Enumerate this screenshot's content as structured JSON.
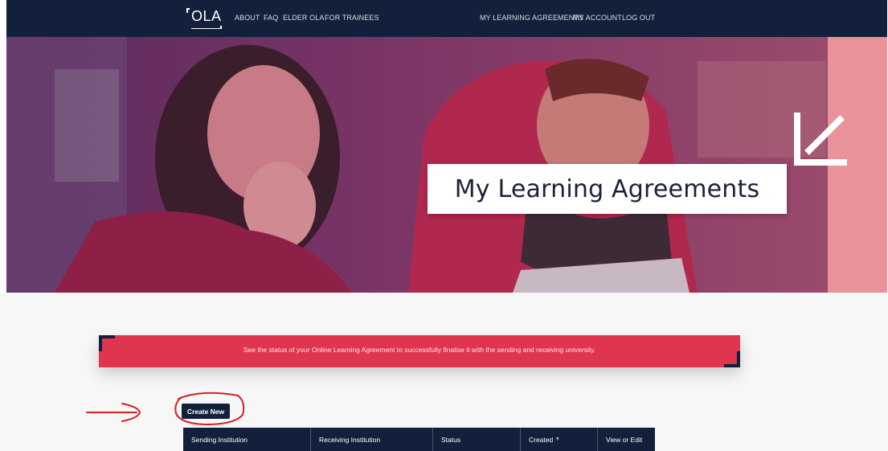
{
  "nav": {
    "logo_text": "OLA",
    "left_links": [
      "ABOUT",
      "FAQ",
      "ELDER OLA",
      "FOR TRAINEES"
    ],
    "right_links": [
      "MY LEARNING AGREEMENTS",
      "MY ACCOUNT",
      "LOG OUT"
    ]
  },
  "hero": {
    "title": "My Learning Agreements"
  },
  "banner": {
    "text": "See the status of your Online Learning Agreement to successfully finalise it with the sending and receiving university."
  },
  "actions": {
    "create_new_label": "Create New"
  },
  "table": {
    "columns": [
      "Sending Institution",
      "Receiving Institution",
      "Status",
      "Created",
      "View or Edit"
    ],
    "sort_indicator": "▼"
  },
  "colors": {
    "navy": "#13203b",
    "accent_red": "#e0354e",
    "hero_pink": "#e9929a",
    "annotation_red": "#d42020"
  },
  "icons": {
    "hero_corner": "arrow-down-left-icon",
    "sort": "caret-down-icon"
  }
}
